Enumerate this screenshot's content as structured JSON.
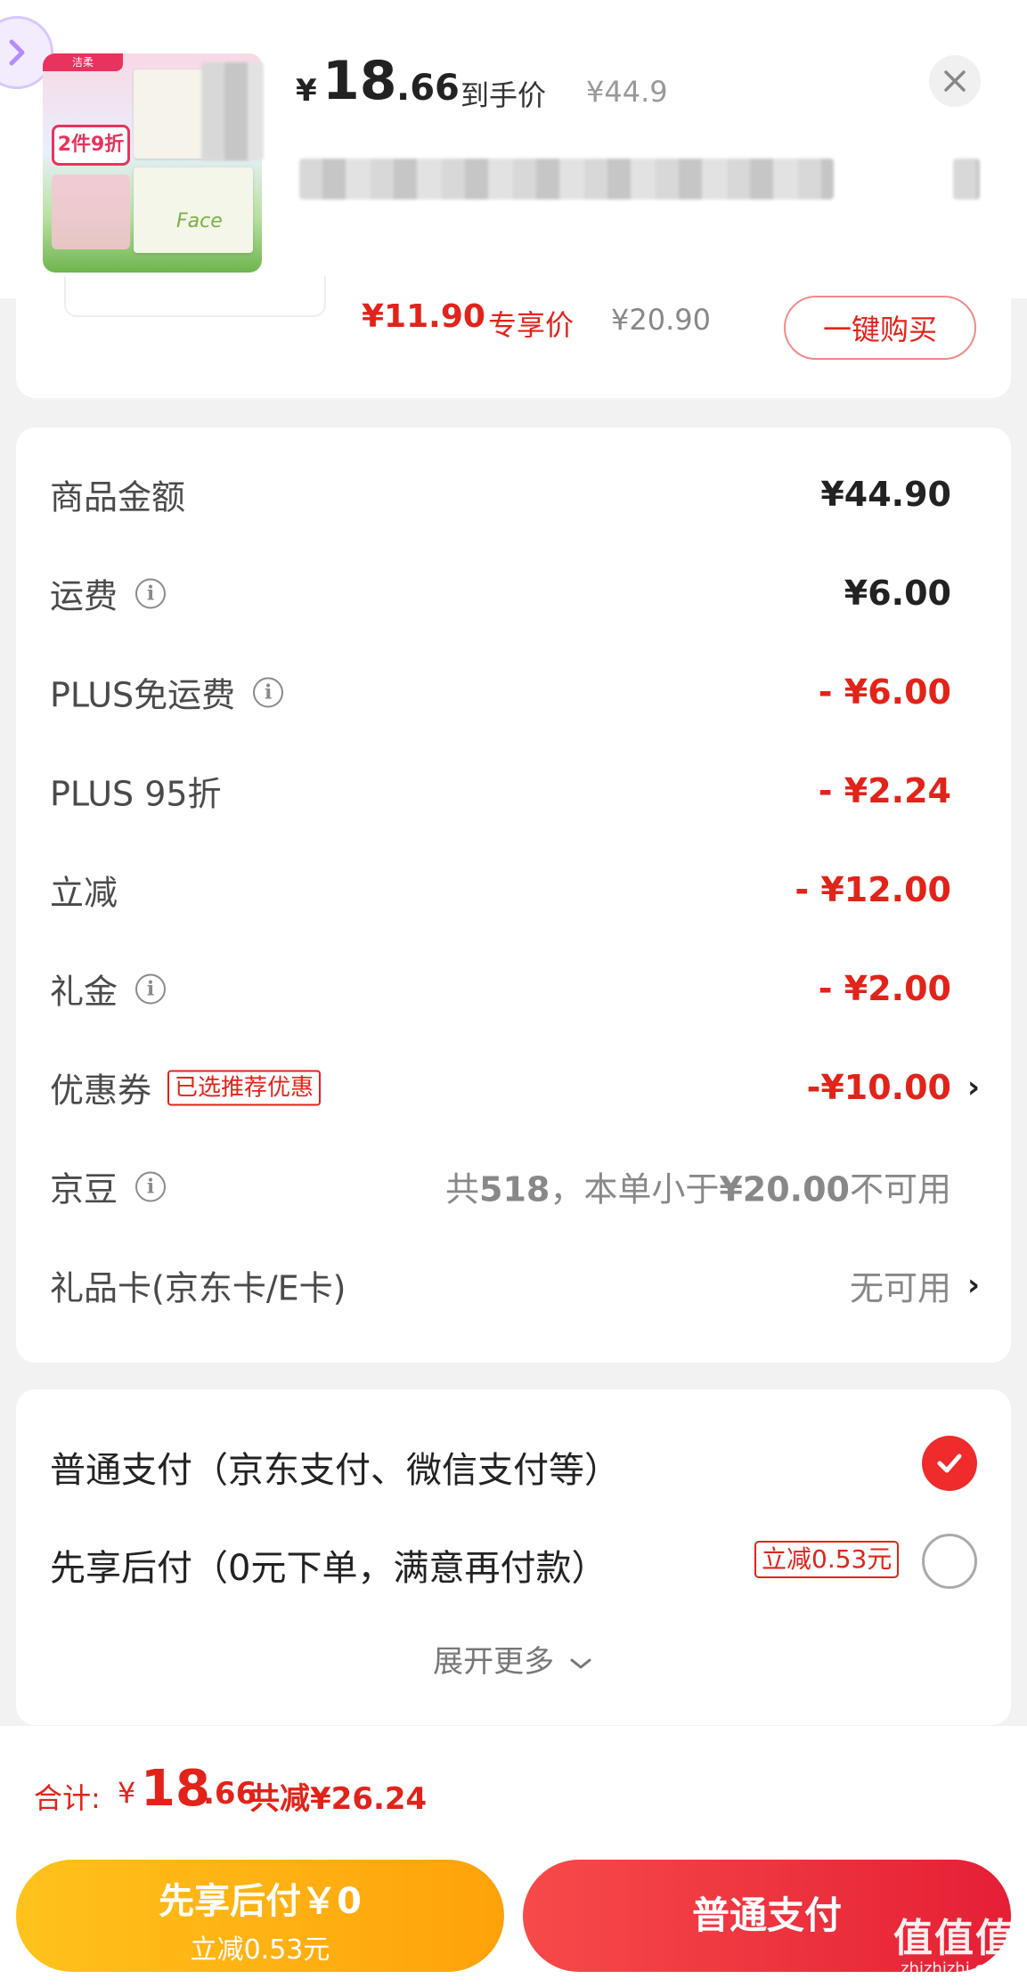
{
  "header": {
    "thumbnail": {
      "tag_text": "洁柔",
      "promo_text": "2件9折",
      "brand_text": "Face"
    },
    "price_symbol": "¥",
    "price_integer": "18",
    "price_decimal": ".66",
    "price_label": "到手价",
    "original_price": "¥44.9",
    "close_label": "×"
  },
  "recommendation": {
    "price": "¥11.90",
    "price_label": "专享价",
    "original_price": "¥20.90",
    "buy_label": "一键购买"
  },
  "summary": {
    "rows": [
      {
        "label": "商品金额",
        "value": "¥44.90"
      },
      {
        "label": "运费",
        "value": "¥6.00"
      },
      {
        "label": "PLUS免运费",
        "value": "- ¥6.00"
      },
      {
        "label": "PLUS 95折",
        "value": "- ¥2.24"
      },
      {
        "label": "立减",
        "value": "- ¥12.00"
      },
      {
        "label": "礼金",
        "value": "- ¥2.00"
      },
      {
        "label": "优惠券",
        "badge": "已选推荐优惠",
        "value": "-¥10.00"
      },
      {
        "label": "京豆",
        "value_prefix": "共",
        "value_count": "518",
        "value_mid": "，本单小于",
        "value_amount": "¥20.00",
        "value_suffix": "不可用"
      },
      {
        "label": "礼品卡(京东卡/E卡)",
        "value": "无可用"
      }
    ]
  },
  "payment": {
    "options": [
      {
        "label": "普通支付（京东支付、微信支付等）",
        "selected": true
      },
      {
        "label": "先享后付（0元下单，满意再付款）",
        "badge": "立减0.53元",
        "selected": false
      }
    ],
    "expand_label": "展开更多"
  },
  "footer": {
    "total_label": "合计:",
    "total_symbol": "¥",
    "total_integer": "18",
    "total_decimal": ".66",
    "total_saved": "共减¥26.24",
    "pay_later_main": "先享后付￥0",
    "pay_later_sub": "立减0.53元",
    "pay_normal": "普通支付"
  },
  "watermark": {
    "main": "值值值",
    "sub": "zhizhizhi.com"
  },
  "colors": {
    "accent_red": "#e2231a",
    "pay_later_yellow": "#ffb013",
    "pay_normal_red": "#ef2b3a",
    "background": "#f2f2f2"
  },
  "icons": [
    "back-arrow-icon",
    "close-icon",
    "info-icon",
    "chevron-right-icon",
    "checkmark-icon",
    "chevron-down-icon"
  ]
}
